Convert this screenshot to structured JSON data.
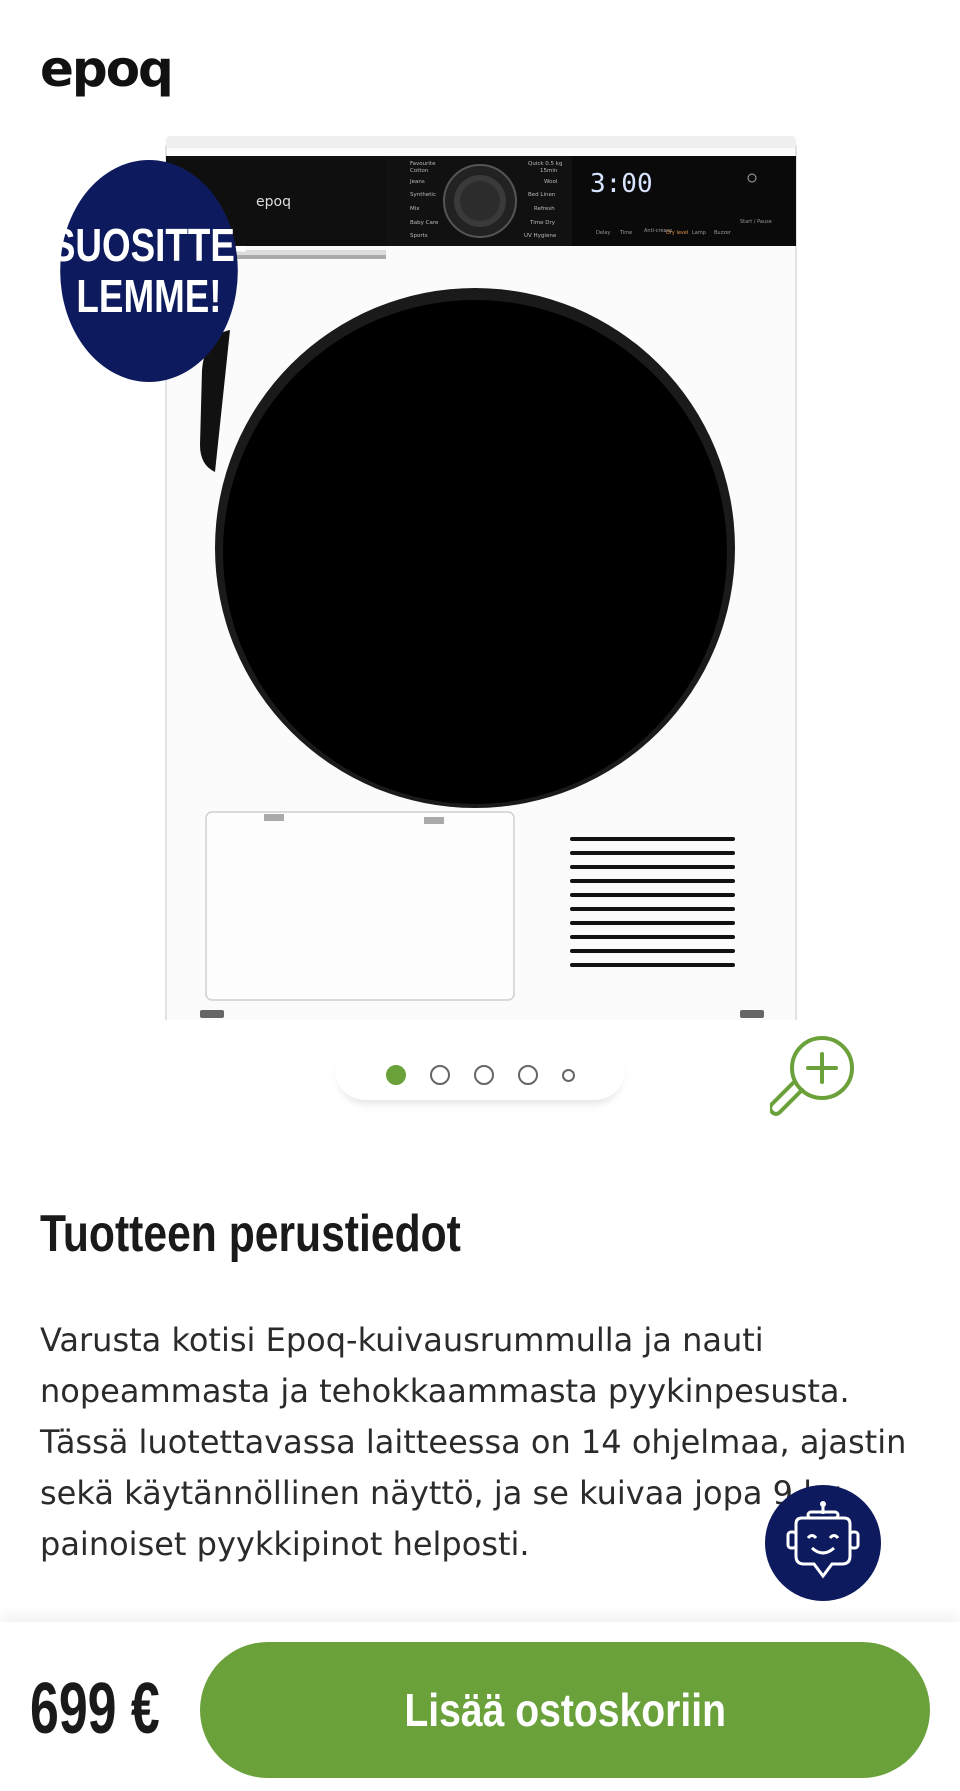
{
  "header": {
    "logo_text": "epoq"
  },
  "product_image": {
    "badge_line1": "SUOSITTE-",
    "badge_line2": "LEMME!",
    "appliance_brand": "epoq",
    "display_time": "3:00",
    "panel_labels_left": [
      "Favourite",
      "Cotton",
      "Jeans",
      "Synthetic",
      "Mix",
      "Baby Care",
      "Sports"
    ],
    "panel_labels_right": [
      "Quick 0.5 kg",
      "15min",
      "Wool",
      "Bed Linen",
      "Refresh",
      "Time Dry",
      "UV Hygiene"
    ],
    "panel_buttons": [
      "Delay",
      "Time",
      "Anti-crease",
      "Dry level",
      "Lamp",
      "Buzzer",
      "Start / Pause"
    ],
    "carousel_count": 5,
    "carousel_active": 0
  },
  "info": {
    "heading": "Tuotteen perustiedot",
    "description": "Varusta kotisi Epoq-kuivausrummulla ja nauti nopeammasta ja tehokkaammasta pyykinpesusta. Tässä luotettavassa laitteessa on 14 ohjelmaa, ajastin sekä käytännöllinen näyttö, ja se kuivaa jopa 9 kg painoiset pyykkipinot helposti."
  },
  "footer": {
    "price": "699 €",
    "add_to_cart": "Lisää ostoskoriin"
  },
  "colors": {
    "accent_green": "#6aa13a",
    "navy": "#0d1b5e"
  }
}
